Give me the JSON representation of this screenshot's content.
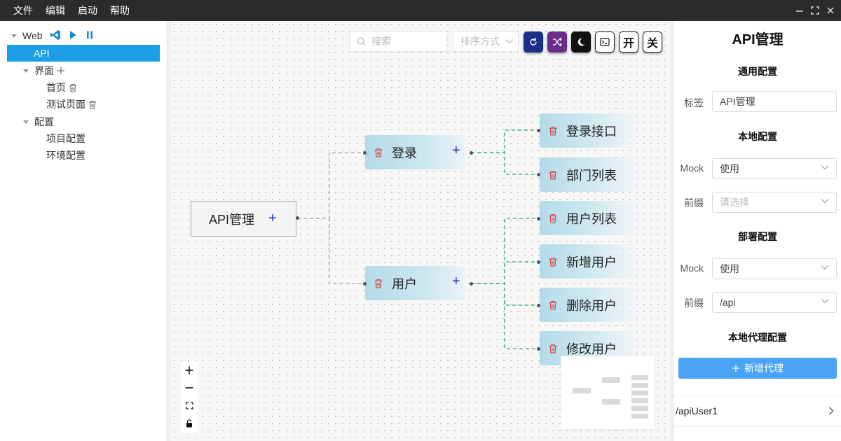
{
  "menu": [
    "文件",
    "编辑",
    "启动",
    "帮助"
  ],
  "sidebar": {
    "root_label": "Web",
    "selected_label": "API",
    "groups": [
      {
        "label": "界面",
        "children": [
          "首页",
          "测试页面"
        ]
      },
      {
        "label": "配置",
        "children": [
          "项目配置",
          "环境配置"
        ]
      }
    ]
  },
  "canvas": {
    "search_placeholder": "搜索",
    "sort_placeholder": "排序方式",
    "toolbar": {
      "on_label": "开",
      "off_label": "关"
    },
    "toolbar_colors": {
      "refresh": "#1a2f8a",
      "shuffle": "#6b2d8a",
      "theme": "#111111"
    },
    "root_node": "API管理",
    "mid_nodes": [
      "登录",
      "用户"
    ],
    "leaf_nodes": [
      "登录接口",
      "部门列表",
      "用户列表",
      "新增用户",
      "删除用户",
      "修改用户"
    ]
  },
  "panel": {
    "title": "API管理",
    "general_section": "通用配置",
    "tag_label": "标签",
    "tag_value": "API管理",
    "local_section": "本地配置",
    "local_mock_label": "Mock",
    "local_mock_value": "使用",
    "local_prefix_label": "前缀",
    "local_prefix_placeholder": "请选择",
    "deploy_section": "部署配置",
    "deploy_mock_label": "Mock",
    "deploy_mock_value": "使用",
    "deploy_prefix_label": "前缀",
    "deploy_prefix_value": "/api",
    "proxy_section": "本地代理配置",
    "add_proxy_label": "新增代理",
    "proxy_items": [
      "/apiUser1"
    ]
  },
  "colors": {
    "accent": "#1c9fe6",
    "button": "#4aa3f5",
    "edge_green": "#2db36b",
    "titlebar": "#2b2b2b"
  }
}
